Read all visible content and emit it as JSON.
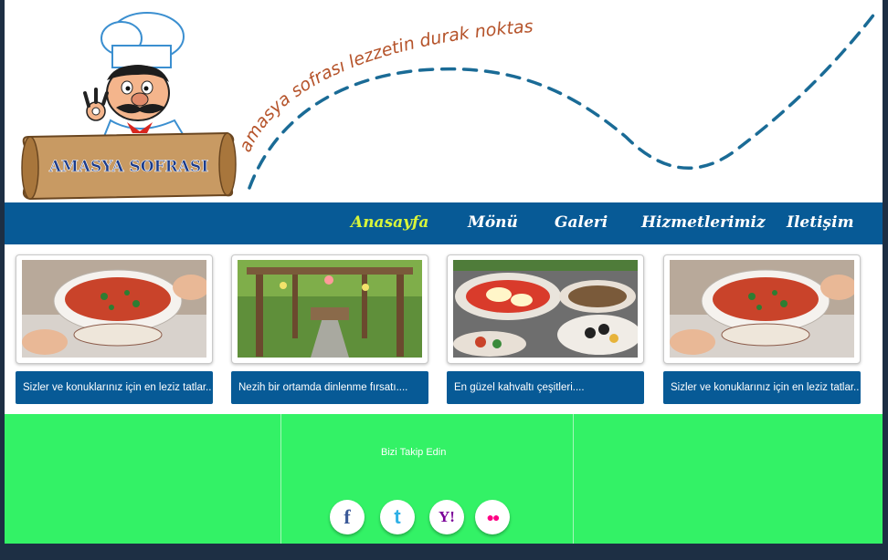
{
  "brand": {
    "logo_text": "AMASYA SOFRASI",
    "slogan": "amasya sofrası lezzetin durak noktası"
  },
  "nav": {
    "items": [
      {
        "label": "Anasayfa",
        "active": true
      },
      {
        "label": "Mönü",
        "active": false
      },
      {
        "label": "Galeri",
        "active": false
      },
      {
        "label": "Hizmetlerimiz",
        "active": false
      },
      {
        "label": "Iletişim",
        "active": false
      }
    ]
  },
  "cards": [
    {
      "caption": "Sizler ve konuklarınız için en leziz tatlar..",
      "image": "soup-bowl"
    },
    {
      "caption": "Nezih bir ortamda dinlenme fırsatı....",
      "image": "garden-pergola"
    },
    {
      "caption": "En güzel kahvaltı çeşitleri....",
      "image": "breakfast-plates"
    },
    {
      "caption": "Sizler ve konuklarınız için en leziz tatlar..",
      "image": "soup-bowl"
    }
  ],
  "footer": {
    "follow_title": "Bizi Takip Edin",
    "social": [
      {
        "name": "facebook",
        "glyph": "f",
        "color": "#3b5998"
      },
      {
        "name": "twitter",
        "glyph": "t",
        "color": "#2fb0e6"
      },
      {
        "name": "yahoo",
        "glyph": "Y!",
        "color": "#7b0099"
      },
      {
        "name": "flickr",
        "glyph": "●●",
        "color": "#ff0084"
      }
    ]
  },
  "colors": {
    "nav_bg": "#075a96",
    "nav_active": "#d8f53a",
    "footer_bg": "#33f266",
    "frame": "#1d2f44",
    "slogan": "#b5532a"
  }
}
